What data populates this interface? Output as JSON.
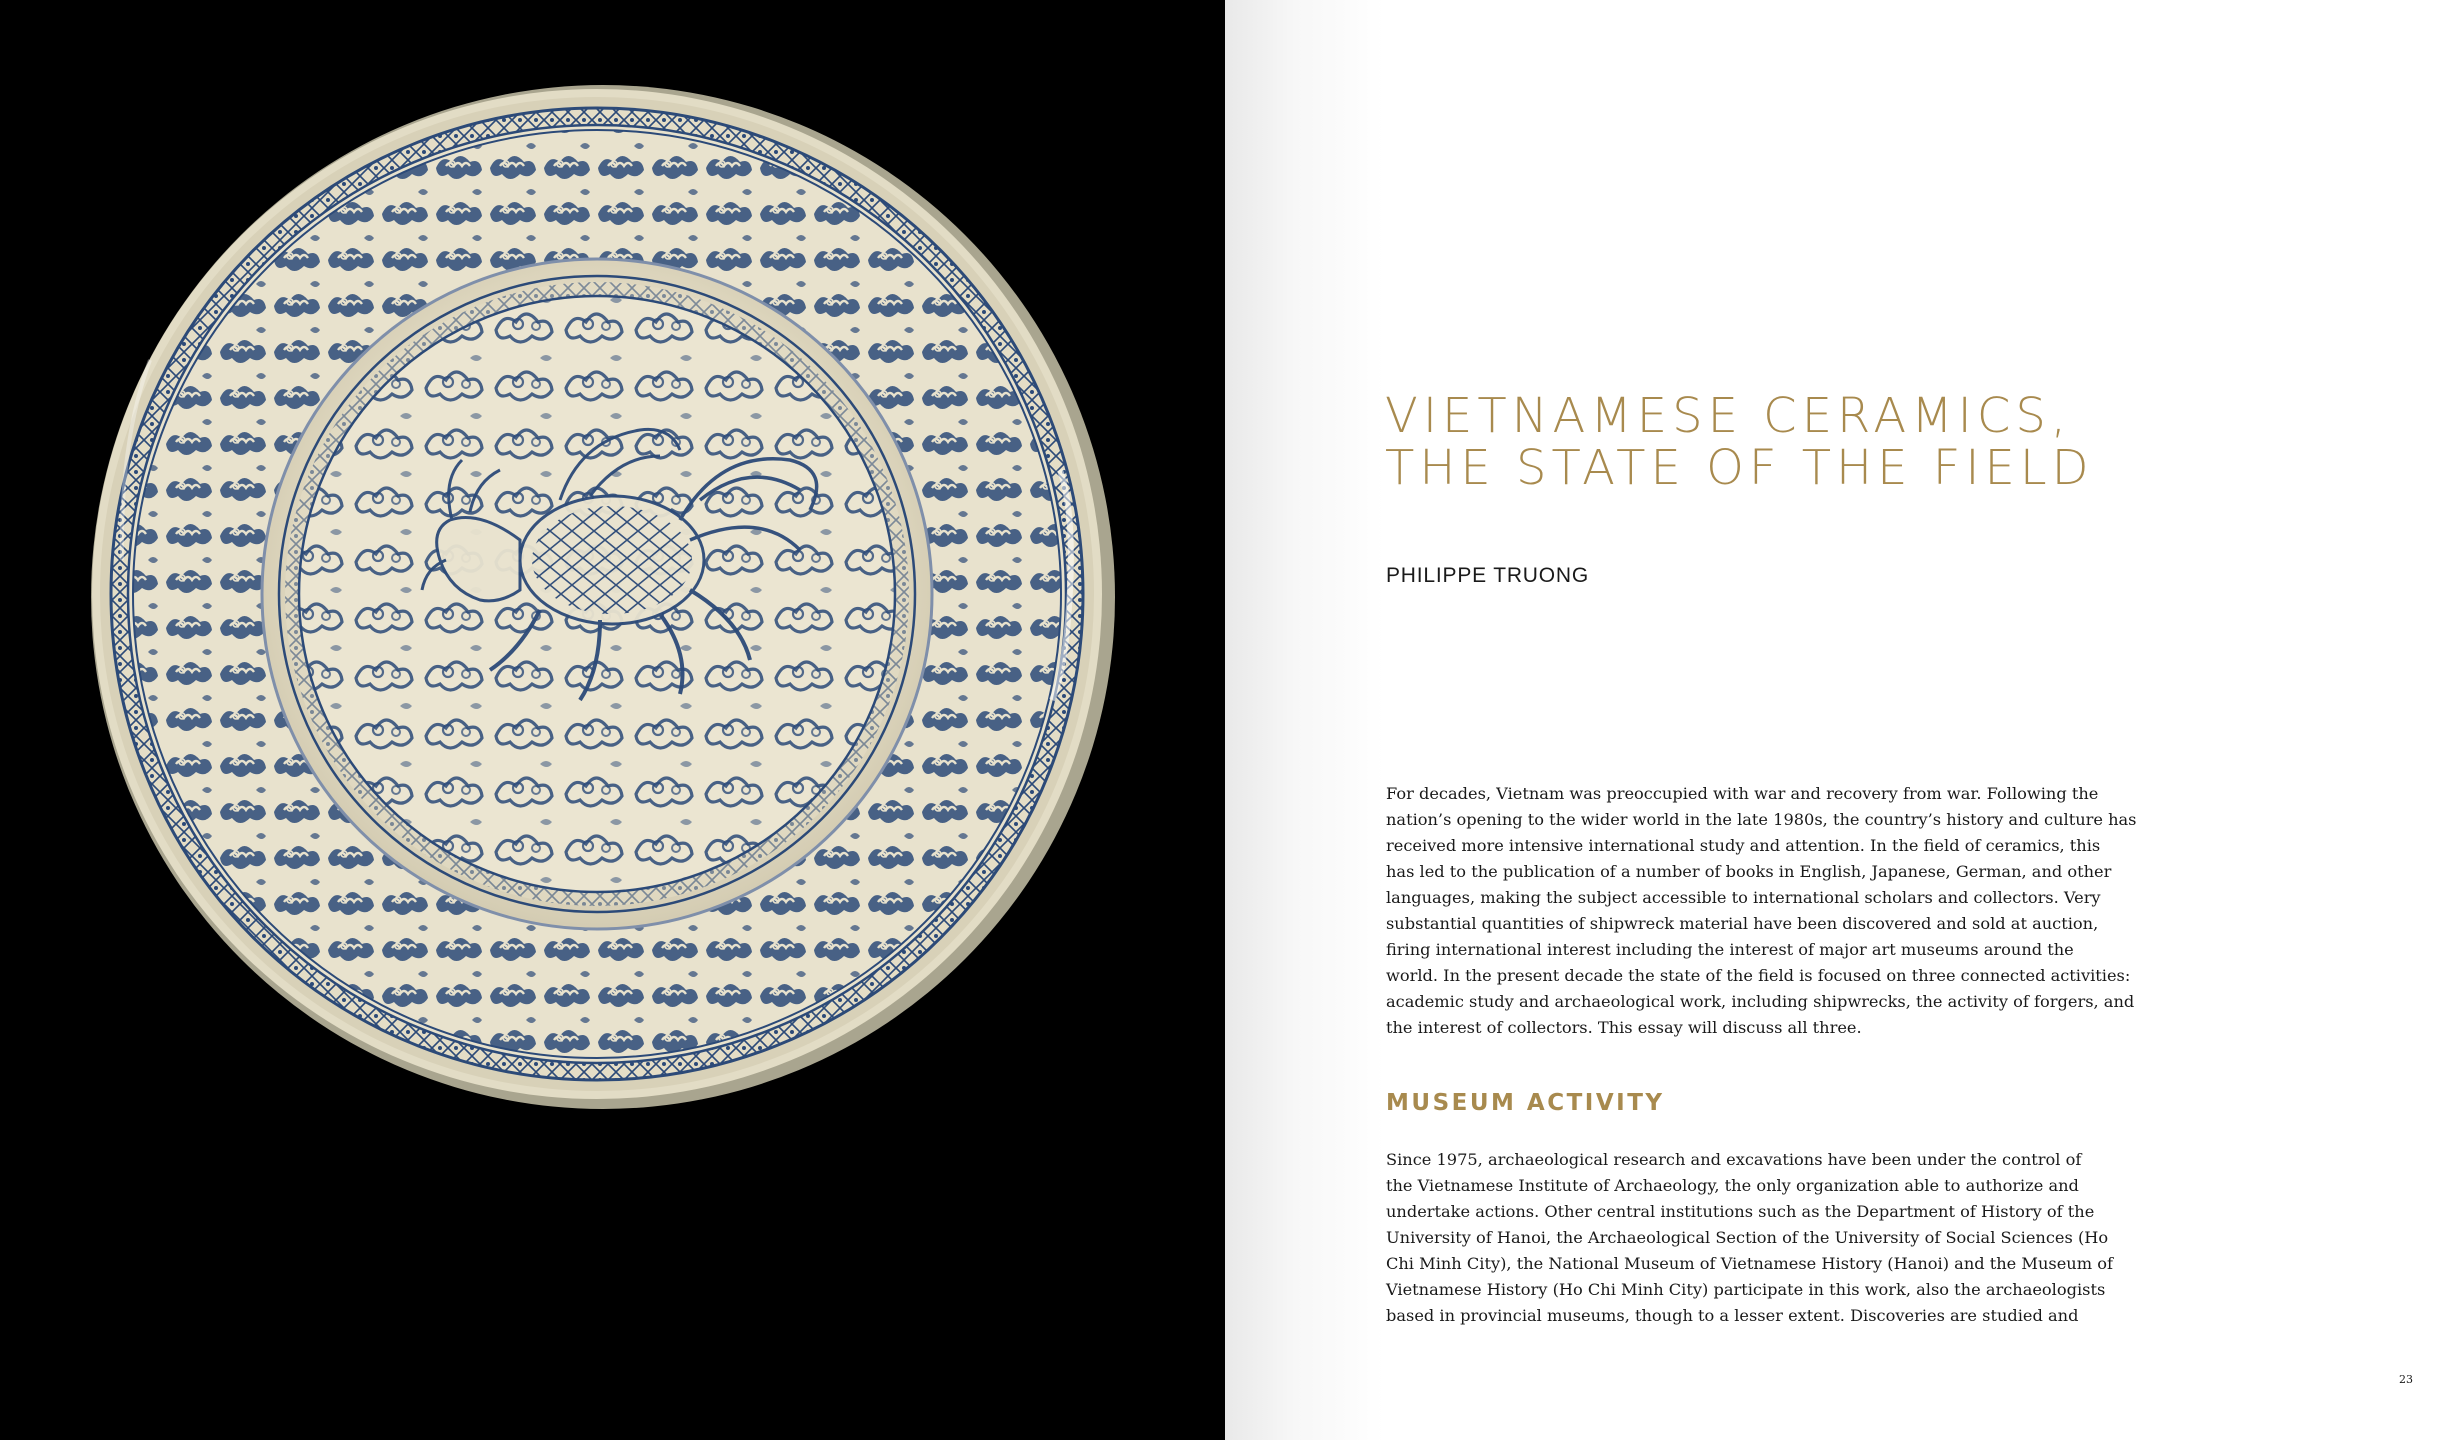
{
  "title": {
    "line1": "VIETNAMESE CERAMICS,",
    "line2": "THE STATE OF THE FIELD"
  },
  "author": "PHILIPPE TRUONG",
  "intro_lines": [
    "For decades, Vietnam was preoccupied with war and recovery from war. Following the",
    "nation’s opening to the wider world in the late 1980s, the country’s history and culture has",
    "received more intensive international study and attention. In the field of ceramics, this",
    "has led to the publication of a number of books in English, Japanese, German, and other",
    "languages, making the subject accessible to international scholars and collectors. Very",
    "substantial quantities of shipwreck material have been discovered and sold at auction,",
    "firing international interest including the interest of major art museums around the",
    "world. In the present decade the state of the field is focused on three connected activities:",
    "academic study and archaeological work, including shipwrecks, the activity of forgers, and",
    "the interest of collectors. This essay will discuss all three."
  ],
  "section_heading": "MUSEUM ACTIVITY",
  "museum_lines": [
    "Since 1975, archaeological research and excavations have been under the control of",
    "the Vietnamese Institute of Archaeology, the only organization able to authorize and",
    "undertake actions. Other central institutions such as the Department of History of the",
    "University of Hanoi, the Archaeological Section of the University of Social Sciences (Ho",
    "Chi Minh City), the National Museum of Vietnamese History (Hanoi) and the Museum of",
    "Vietnamese History (Ho Chi Minh City) participate in this work, also the archaeologists",
    "based in provincial museums, though to a lesser extent. Discoveries are studied and"
  ],
  "page_number": "23",
  "colors": {
    "accent_gold": "#a88a4e",
    "text": "#1a1a1a",
    "photo_background": "#000000",
    "glaze": "#ece6d2",
    "cobalt": "#2c4a78"
  },
  "image": {
    "subject": "blue-and-white porcelain dish with qilin and cloud motifs"
  }
}
